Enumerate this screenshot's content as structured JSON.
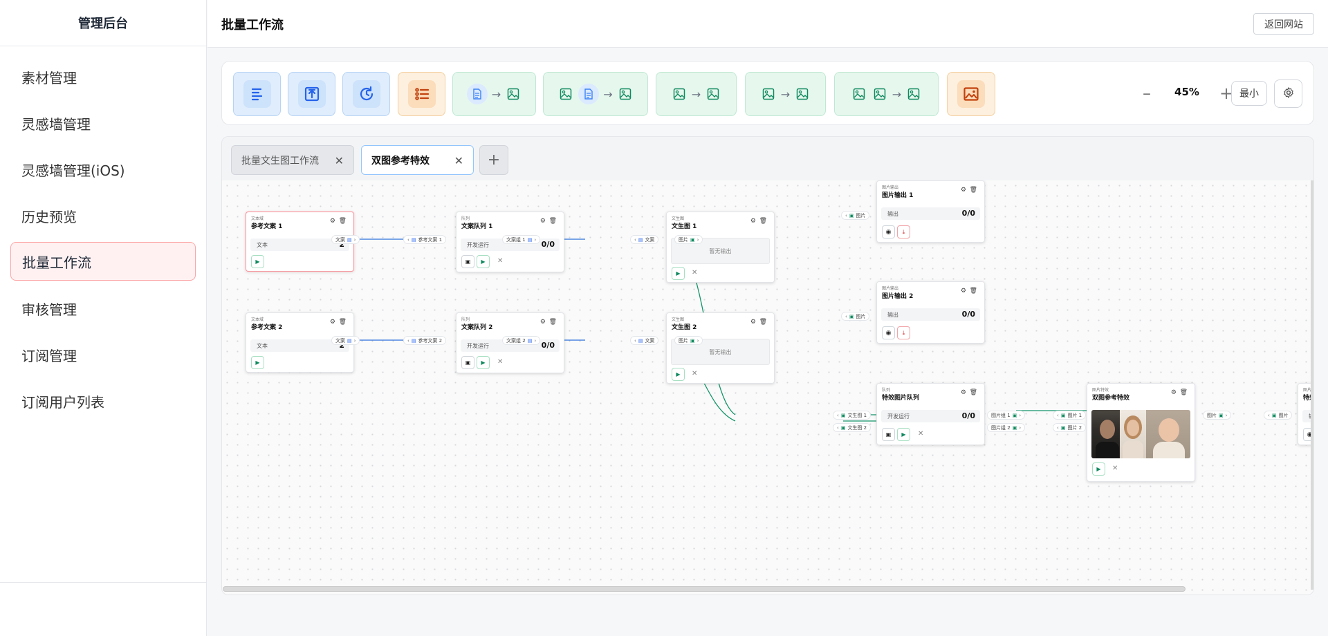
{
  "sidebar": {
    "brand": "管理后台",
    "items": [
      {
        "label": "素材管理",
        "active": false
      },
      {
        "label": "灵感墙管理",
        "active": false
      },
      {
        "label": "灵感墙管理(iOS)",
        "active": false
      },
      {
        "label": "历史预览",
        "active": false
      },
      {
        "label": "批量工作流",
        "active": true
      },
      {
        "label": "审核管理",
        "active": false
      },
      {
        "label": "订阅管理",
        "active": false
      },
      {
        "label": "订阅用户列表",
        "active": false
      }
    ]
  },
  "header": {
    "title": "批量工作流",
    "back_label": "返回网站"
  },
  "toolbar": {
    "tools": [
      {
        "name": "text-node-tool",
        "icon": "text-lines-icon"
      },
      {
        "name": "upload-node-tool",
        "icon": "upload-icon"
      },
      {
        "name": "history-node-tool",
        "icon": "history-icon"
      },
      {
        "name": "queue-node-tool",
        "icon": "list-icon"
      },
      {
        "name": "text-to-image-tool",
        "icon": "document-to-image-icon"
      },
      {
        "name": "image-text-to-image-tool",
        "icon": "image-document-to-image-icon"
      },
      {
        "name": "image-to-image-tool",
        "icon": "image-to-image-icon"
      },
      {
        "name": "image-to-image-tool-2",
        "icon": "image-to-image-icon"
      },
      {
        "name": "two-images-to-image-tool",
        "icon": "two-images-to-image-icon"
      },
      {
        "name": "image-output-tool",
        "icon": "image-frame-icon"
      }
    ],
    "zoom": "45%",
    "min_label": "最小"
  },
  "tabs": [
    {
      "label": "批量文生图工作流",
      "active": false
    },
    {
      "label": "双图参考特效",
      "active": true
    }
  ],
  "colors": {
    "blue_edge": "#2b6fdc",
    "green_edge": "#13956a",
    "accent_red": "#f19aa0"
  },
  "nodes": {
    "text1": {
      "type": "文本域",
      "title": "参考文案 1",
      "row_label": "文本",
      "row_value": "2"
    },
    "text2": {
      "type": "文本域",
      "title": "参考文案 2",
      "row_label": "文本",
      "row_value": "2"
    },
    "queue1": {
      "type": "队列",
      "title": "文案队列 1",
      "row_label": "开发运行",
      "row_value": "0/0"
    },
    "queue2": {
      "type": "队列",
      "title": "文案队列 2",
      "row_label": "开发运行",
      "row_value": "0/0"
    },
    "t2i1": {
      "type": "文生图",
      "title": "文生图 1",
      "placeholder": "暂无输出"
    },
    "t2i2": {
      "type": "文生图",
      "title": "文生图 2",
      "placeholder": "暂无输出"
    },
    "out1": {
      "type": "图片输出",
      "title": "图片输出 1",
      "row_label": "输出",
      "row_value": "0/0"
    },
    "out2": {
      "type": "图片输出",
      "title": "图片输出 2",
      "row_label": "输出",
      "row_value": "0/0"
    },
    "fxq": {
      "type": "队列",
      "title": "特效图片队列",
      "row_label": "开发运行",
      "row_value": "0/0"
    },
    "fx": {
      "type": "图片特效",
      "title": "双图参考特效"
    },
    "edge": {
      "type": "图片特效",
      "title": "特效",
      "row_label": "输"
    }
  },
  "ports": {
    "text": "文案",
    "ref1": "参考文案 1",
    "ref2": "参考文案 2",
    "group1": "文案组 1",
    "group2": "文案组 2",
    "image": "图片",
    "tuwen1": "文生图 1",
    "tuwen2": "文生图 2",
    "imggroup1": "图片组 1",
    "imggroup2": "图片组 2",
    "img1": "图片 1",
    "img2": "图片 2"
  }
}
